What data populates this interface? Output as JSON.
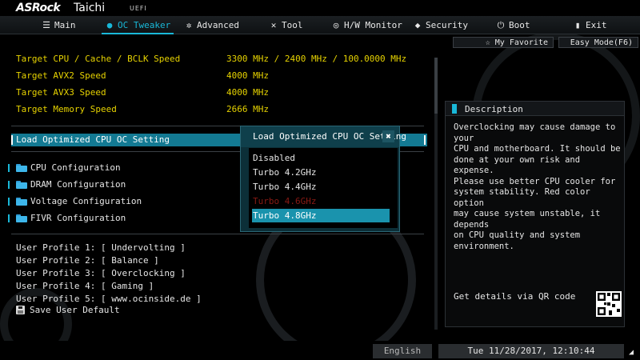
{
  "brand": {
    "logo": "ASRock",
    "model": "Taichi",
    "uefi": "UEFI"
  },
  "nav": {
    "tabs": [
      {
        "label": "Main",
        "icon": "list-icon"
      },
      {
        "label": "OC Tweaker",
        "icon": "droplet-icon"
      },
      {
        "label": "Advanced",
        "icon": "star-icon"
      },
      {
        "label": "Tool",
        "icon": "wrench-icon"
      },
      {
        "label": "H/W Monitor",
        "icon": "monitor-icon"
      },
      {
        "label": "Security",
        "icon": "shield-icon"
      },
      {
        "label": "Boot",
        "icon": "power-icon"
      },
      {
        "label": "Exit",
        "icon": "exit-icon"
      }
    ],
    "active": "OC Tweaker"
  },
  "targets": [
    {
      "label": "Target CPU / Cache / BCLK Speed",
      "value": "3300 MHz / 2400 MHz / 100.0000 MHz"
    },
    {
      "label": "Target AVX2 Speed",
      "value": "4000 MHz"
    },
    {
      "label": "Target AVX3 Speed",
      "value": "4000 MHz"
    },
    {
      "label": "Target Memory Speed",
      "value": "2666 MHz"
    }
  ],
  "oc_setting": {
    "label": "Load Optimized CPU OC Setting"
  },
  "configs": [
    {
      "label": "CPU Configuration"
    },
    {
      "label": "DRAM Configuration"
    },
    {
      "label": "Voltage Configuration"
    },
    {
      "label": "FIVR Configuration"
    }
  ],
  "profiles": [
    "User Profile 1: [ Undervolting ]",
    "User Profile 2: [ Balance ]",
    "User Profile 3: [ Overclocking ]",
    "User Profile 4: [ Gaming ]",
    "User Profile 5: [ www.ocinside.de ]"
  ],
  "save_user_default": "Save User Default",
  "popup": {
    "title": "Load Optimized CPU OC Setting",
    "options": [
      {
        "label": "Disabled",
        "state": "normal"
      },
      {
        "label": "Turbo 4.2GHz",
        "state": "normal"
      },
      {
        "label": "Turbo 4.4GHz",
        "state": "normal"
      },
      {
        "label": "Turbo 4.6GHz",
        "state": "disabled"
      },
      {
        "label": "Turbo 4.8GHz",
        "state": "selected"
      }
    ],
    "close_symbol": "✖"
  },
  "side": {
    "my_favorite": "My Favorite",
    "easy_mode": "Easy Mode(F6)"
  },
  "description": {
    "title": "Description",
    "text": "Overclocking may cause damage to your\nCPU and motherboard. It should be\ndone at your own risk and expense.\nPlease use better CPU cooler for\nsystem stability. Red color option\nmay cause system unstable, it depends\non CPU quality and system environment.",
    "qr_label": "Get details via QR code"
  },
  "bottom": {
    "language": "English",
    "datetime": "Tue 11/28/2017, 12:10:44"
  },
  "colors": {
    "accent": "#19b8d8",
    "highlight": "#137a93",
    "target_text": "#e6d200",
    "danger": "#8a1a14"
  }
}
